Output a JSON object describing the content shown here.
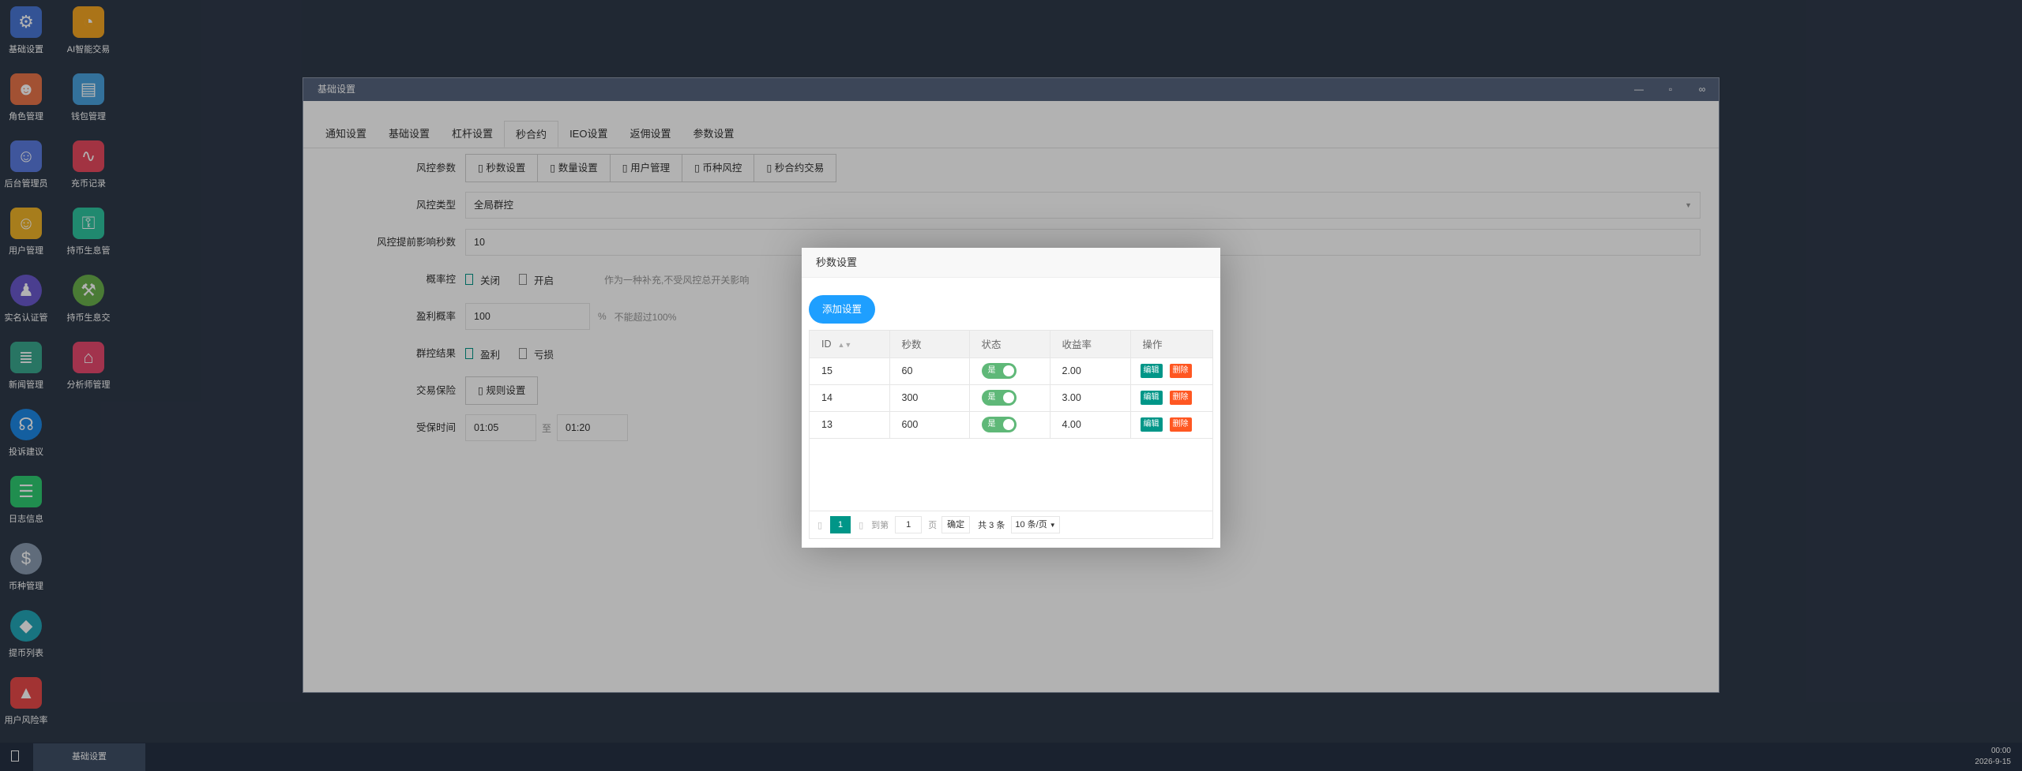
{
  "desktop": {
    "icons": [
      {
        "label": "基础设置",
        "icon": "gear-icon",
        "color": "#4a78d6"
      },
      {
        "label": "AI智能交易",
        "icon": "stopwatch-icon",
        "color": "#f5a623"
      },
      {
        "label": "角色管理",
        "icon": "role-icon",
        "color": "#e8744a"
      },
      {
        "label": "钱包管理",
        "icon": "wallet-icon",
        "color": "#4aa3df"
      },
      {
        "label": "后台管理员",
        "icon": "admin-icon",
        "color": "#5b7be0"
      },
      {
        "label": "充币记录",
        "icon": "chart-record-icon",
        "color": "#e84a5f"
      },
      {
        "label": "用户管理",
        "icon": "user-search-icon",
        "color": "#f0b429"
      },
      {
        "label": "持币生息管",
        "icon": "unlock-icon",
        "color": "#2ec4a0"
      },
      {
        "label": "实名认证管",
        "icon": "verify-icon",
        "color": "#6a5acd"
      },
      {
        "label": "持币生息交",
        "icon": "pickaxe-icon",
        "color": "#6ab04c"
      },
      {
        "label": "新闻管理",
        "icon": "news-icon",
        "color": "#3aa88f"
      },
      {
        "label": "分析师管理",
        "icon": "shop-icon",
        "color": "#e84a6f"
      },
      {
        "label": "投诉建议",
        "icon": "headset-icon",
        "color": "#1e88e5"
      },
      {
        "label": "日志信息",
        "icon": "log-icon",
        "color": "#2ecc71"
      },
      {
        "label": "币种管理",
        "icon": "dollar-icon",
        "color": "#8a9bb0"
      },
      {
        "label": "提币列表",
        "icon": "withdraw-icon",
        "color": "#23a6b8"
      },
      {
        "label": "用户风险率",
        "icon": "alarm-icon",
        "color": "#e84a4a"
      }
    ]
  },
  "window": {
    "title": "基础设置",
    "controls": {
      "minimize": "—",
      "maximize": "▫",
      "restore": "∞"
    },
    "tabs": [
      "通知设置",
      "基础设置",
      "杠杆设置",
      "秒合约",
      "IEO设置",
      "返佣设置",
      "参数设置"
    ],
    "active_tab": 3,
    "form": {
      "risk_params": {
        "label": "风控参数",
        "buttons": [
          "秒数设置",
          "数量设置",
          "用户管理",
          "币种风控",
          "秒合约交易"
        ]
      },
      "risk_type": {
        "label": "风控类型",
        "value": "全局群控"
      },
      "lead_seconds": {
        "label": "风控提前影响秒数",
        "value": "10"
      },
      "probability": {
        "label": "概率控",
        "options": [
          "关闭",
          "开启"
        ],
        "hint": "作为一种补充,不受风控总开关影响"
      },
      "win_rate": {
        "label": "盈利概率",
        "value": "100",
        "unit": "%",
        "hint": "不能超过100%"
      },
      "group_result": {
        "label": "群控结果",
        "options": [
          "盈利",
          "亏损"
        ]
      },
      "trade_insurance": {
        "label": "交易保险",
        "button": "规则设置"
      },
      "insured_time": {
        "label": "受保时间",
        "start": "01:05",
        "sep": "至",
        "end": "01:20"
      }
    }
  },
  "dialog": {
    "title": "秒数设置",
    "add_button": "添加设置",
    "columns": [
      "ID",
      "秒数",
      "状态",
      "收益率",
      "操作"
    ],
    "rows": [
      {
        "id": "15",
        "seconds": "60",
        "status": "是",
        "rate": "2.00"
      },
      {
        "id": "14",
        "seconds": "300",
        "status": "是",
        "rate": "3.00"
      },
      {
        "id": "13",
        "seconds": "600",
        "status": "是",
        "rate": "4.00"
      }
    ],
    "actions": {
      "edit": "编辑",
      "delete": "删除"
    },
    "pager": {
      "current": "1",
      "goto_label": "到第",
      "goto_value": "1",
      "page_unit": "页",
      "confirm": "确定",
      "total": "共 3 条",
      "page_size": "10 条/页"
    }
  },
  "taskbar": {
    "item": "基础设置",
    "time": "00:00",
    "date": "2026-9-15"
  }
}
